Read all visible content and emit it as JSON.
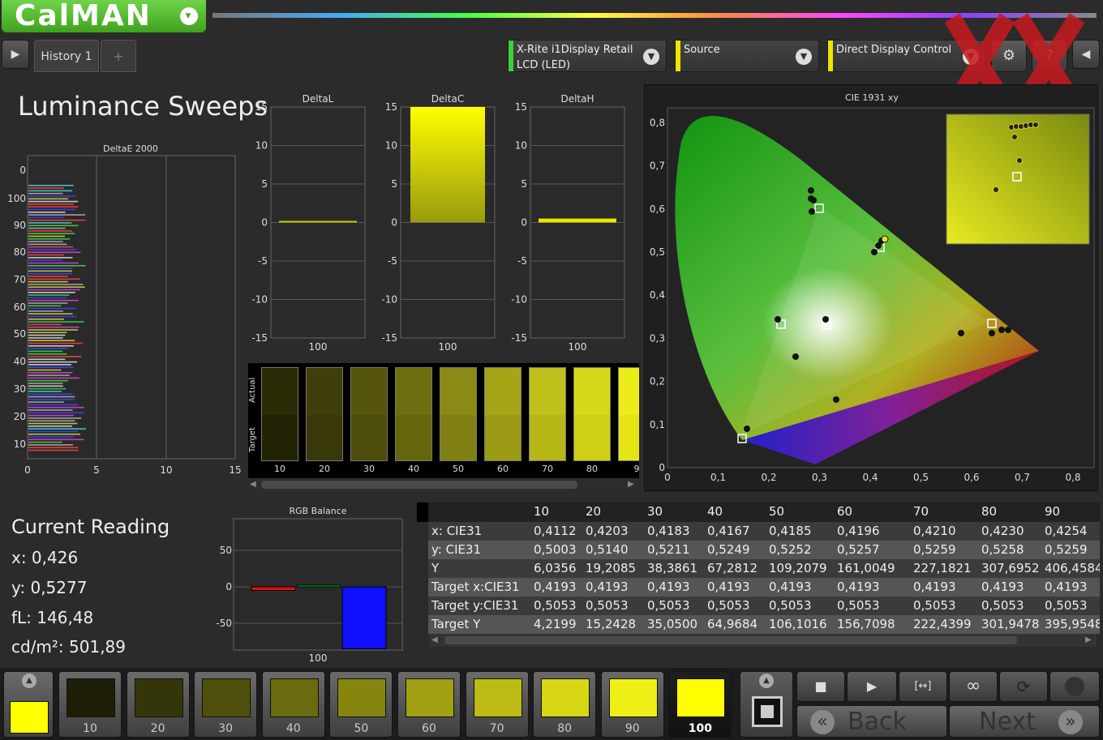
{
  "app": {
    "logo": "CalMAN",
    "logo_arrow": "▾"
  },
  "tabs": {
    "history_label": "History 1",
    "add_label": "+",
    "nav_left": "▶",
    "nav_right": "◀"
  },
  "dropdowns": [
    {
      "label_line1": "X-Rite i1Display Retail",
      "label_line2": "LCD (LED)",
      "color": "#3bd13b"
    },
    {
      "label_line1": "Source",
      "label_line2": "",
      "color": "#f0e500"
    },
    {
      "label_line1": "Direct Display Control",
      "label_line2": "",
      "color": "#f0e500"
    }
  ],
  "toolbar": {
    "settings_icon": "⚙",
    "help_icon": "?"
  },
  "page_title": "Luminance Sweeps",
  "deltae_chart": {
    "title": "DeltaE 2000",
    "y_ticks": [
      "0",
      "100",
      "90",
      "80",
      "70",
      "60",
      "50",
      "40",
      "30",
      "20",
      "10"
    ],
    "x_ticks": [
      "0",
      "5",
      "10",
      "15"
    ]
  },
  "delta_charts": [
    {
      "title": "DeltaL",
      "value": 0,
      "x_label": "100",
      "bar_color": "#c8c800"
    },
    {
      "title": "DeltaC",
      "value": 15,
      "x_label": "100",
      "bar_color": "#ffff00"
    },
    {
      "title": "DeltaH",
      "value": 0.3,
      "x_label": "100",
      "bar_color": "#e8e800"
    }
  ],
  "delta_y_ticks": [
    "15",
    "10",
    "5",
    "0",
    "-5",
    "-10",
    "-15"
  ],
  "swatch_strip": {
    "actual_label": "Actual",
    "target_label": "Target",
    "items": [
      {
        "label": "10",
        "actual": "#2a2a07",
        "target": "#222205"
      },
      {
        "label": "20",
        "actual": "#3f3f0b",
        "target": "#383808"
      },
      {
        "label": "30",
        "actual": "#55550e",
        "target": "#4d4d0b"
      },
      {
        "label": "40",
        "actual": "#6e6e11",
        "target": "#65650e"
      },
      {
        "label": "50",
        "actual": "#8a8a15",
        "target": "#808012"
      },
      {
        "label": "60",
        "actual": "#a5a518",
        "target": "#9b9b15"
      },
      {
        "label": "70",
        "actual": "#c0c01a",
        "target": "#b6b617"
      },
      {
        "label": "80",
        "actual": "#d8d81a",
        "target": "#cfcf18"
      },
      {
        "label": "9",
        "actual": "#ecec18",
        "target": "#e5e516"
      }
    ]
  },
  "cie": {
    "title": "CIE 1931 xy",
    "y_ticks": [
      "0,8",
      "0,7",
      "0,6",
      "0,5",
      "0,4",
      "0,3",
      "0,2",
      "0,1",
      "0"
    ],
    "x_ticks": [
      "0",
      "0,1",
      "0,2",
      "0,3",
      "0,4",
      "0,5",
      "0,6",
      "0,7",
      "0,8"
    ]
  },
  "rgb_balance": {
    "title": "RGB Balance",
    "y_ticks": [
      "50",
      "0",
      "-50"
    ],
    "x_label": "100",
    "bars": [
      {
        "name": "red",
        "value": -5,
        "color": "#e01010"
      },
      {
        "name": "green",
        "value": 0,
        "color": "#10c010"
      },
      {
        "name": "blue",
        "value": -85,
        "color": "#1010ff"
      }
    ]
  },
  "current_reading": {
    "title": "Current Reading",
    "x": "x: 0,426",
    "y": "y: 0,5277",
    "fl": "fL: 146,48",
    "cdm2": "cd/m²: 501,89"
  },
  "table": {
    "headers": [
      "10",
      "20",
      "30",
      "40",
      "50",
      "60",
      "70",
      "80",
      "90"
    ],
    "rows": [
      {
        "label": "x: CIE31",
        "values": [
          "0,4112",
          "0,4203",
          "0,4183",
          "0,4167",
          "0,4185",
          "0,4196",
          "0,4210",
          "0,4230",
          "0,4254"
        ]
      },
      {
        "label": "y: CIE31",
        "values": [
          "0,5003",
          "0,5140",
          "0,5211",
          "0,5249",
          "0,5252",
          "0,5257",
          "0,5259",
          "0,5258",
          "0,5259"
        ]
      },
      {
        "label": "Y",
        "values": [
          "6,0356",
          "19,2085",
          "38,3861",
          "67,2812",
          "109,2079",
          "161,0049",
          "227,1821",
          "307,6952",
          "406,4584"
        ]
      },
      {
        "label": "Target x:CIE31",
        "values": [
          "0,4193",
          "0,4193",
          "0,4193",
          "0,4193",
          "0,4193",
          "0,4193",
          "0,4193",
          "0,4193",
          "0,4193"
        ]
      },
      {
        "label": "Target y:CIE31",
        "values": [
          "0,5053",
          "0,5053",
          "0,5053",
          "0,5053",
          "0,5053",
          "0,5053",
          "0,5053",
          "0,5053",
          "0,5053"
        ]
      },
      {
        "label": "Target Y",
        "values": [
          "4,2199",
          "15,2428",
          "35,0500",
          "64,9684",
          "106,1016",
          "156,7098",
          "222,4399",
          "301,9478",
          "395,9548"
        ]
      }
    ]
  },
  "patches": [
    {
      "label": "10",
      "color": "#1e1e08"
    },
    {
      "label": "20",
      "color": "#35350a"
    },
    {
      "label": "30",
      "color": "#4f4f0c"
    },
    {
      "label": "40",
      "color": "#6a6a0e"
    },
    {
      "label": "50",
      "color": "#858510"
    },
    {
      "label": "60",
      "color": "#a0a012"
    },
    {
      "label": "70",
      "color": "#bcbc14"
    },
    {
      "label": "80",
      "color": "#d7d716"
    },
    {
      "label": "90",
      "color": "#efef18"
    },
    {
      "label": "100",
      "color": "#ffff00"
    }
  ],
  "current_patch_color": "#ffff00",
  "controls": {
    "stop_icon": "■",
    "play_icon": "▶",
    "range_icon": "[↔]",
    "loop_icon": "∞",
    "refresh_icon": "⟳",
    "back_label": "Back",
    "next_label": "Next",
    "back_arrows": "«",
    "next_arrows": "»"
  },
  "colors": {
    "logo_green": "#4fb52b"
  }
}
